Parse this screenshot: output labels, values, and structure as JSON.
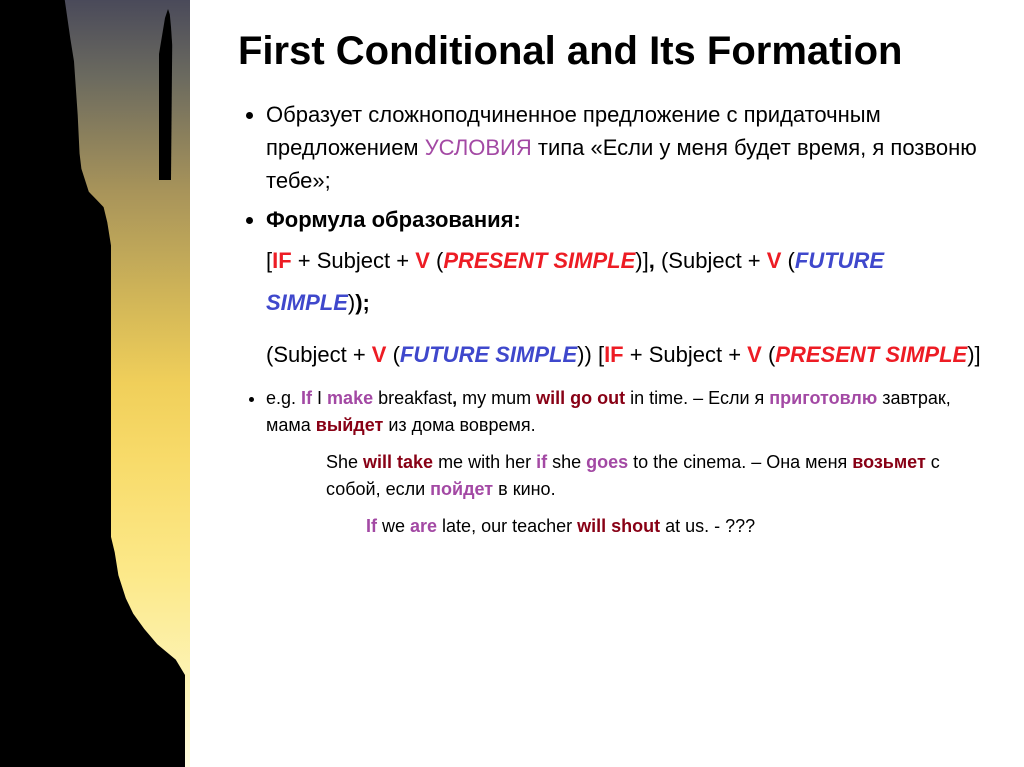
{
  "title": "First Conditional and Its Formation",
  "bullets": {
    "b1_pre": "Образует сложноподчиненное предложение с придаточным предложением ",
    "b1_cond": "УСЛОВИЯ",
    "b1_post": " типа «Если у меня будет время, я позвоню тебе»;",
    "b2": "Формула образования:",
    "f1": {
      "open": "[",
      "if": "IF",
      "p1": " + Subject + ",
      "v": "V",
      "po": " (",
      "ps": "PRESENT SIMPLE",
      "pc": ")",
      "close": "]",
      "comma": ", ",
      "open2": "(",
      "p2": "Subject + ",
      "v2": "V",
      "po2": " (",
      "fs": "FUTURE SIMPLE",
      "pc2": ")",
      "close2": ");"
    },
    "f2": {
      "open": "(",
      "p1": "Subject + ",
      "v": "V",
      "po": " (",
      "fs": "FUTURE SIMPLE",
      "pc": ")",
      "close": ") ",
      "open2": "[",
      "if": "IF",
      "p2": " + Subject + ",
      "v2": "V",
      "po2": " (",
      "ps": "PRESENT SIMPLE",
      "pc2": ")",
      "close2": "]"
    },
    "ex1": {
      "eg": "e.g. ",
      "if": "If",
      "p1": " I ",
      "make": "make",
      "p2": " breakfast",
      "comma": ", ",
      "p3": "my mum ",
      "will": "will go out",
      "p4": " in time. – Если я ",
      "ru1": "приготовлю",
      "p5": " завтрак, мама ",
      "ru2": "выйдет",
      "p6": " из дома вовремя."
    },
    "ex2": {
      "p1": "She ",
      "will": "will take",
      "p2": " me with her ",
      "if": "if",
      "p3": " she ",
      "goes": "goes",
      "p4": " to the cinema. – Она меня ",
      "ru1": "возьмет",
      "p5": " с собой, если ",
      "ru2": "пойдет",
      "p6": " в кино."
    },
    "ex3": {
      "if": "If",
      "p1": " we ",
      "are": "are",
      "p2": " late, our teacher ",
      "will": "will shout",
      "p3": " at us. - ???"
    }
  }
}
